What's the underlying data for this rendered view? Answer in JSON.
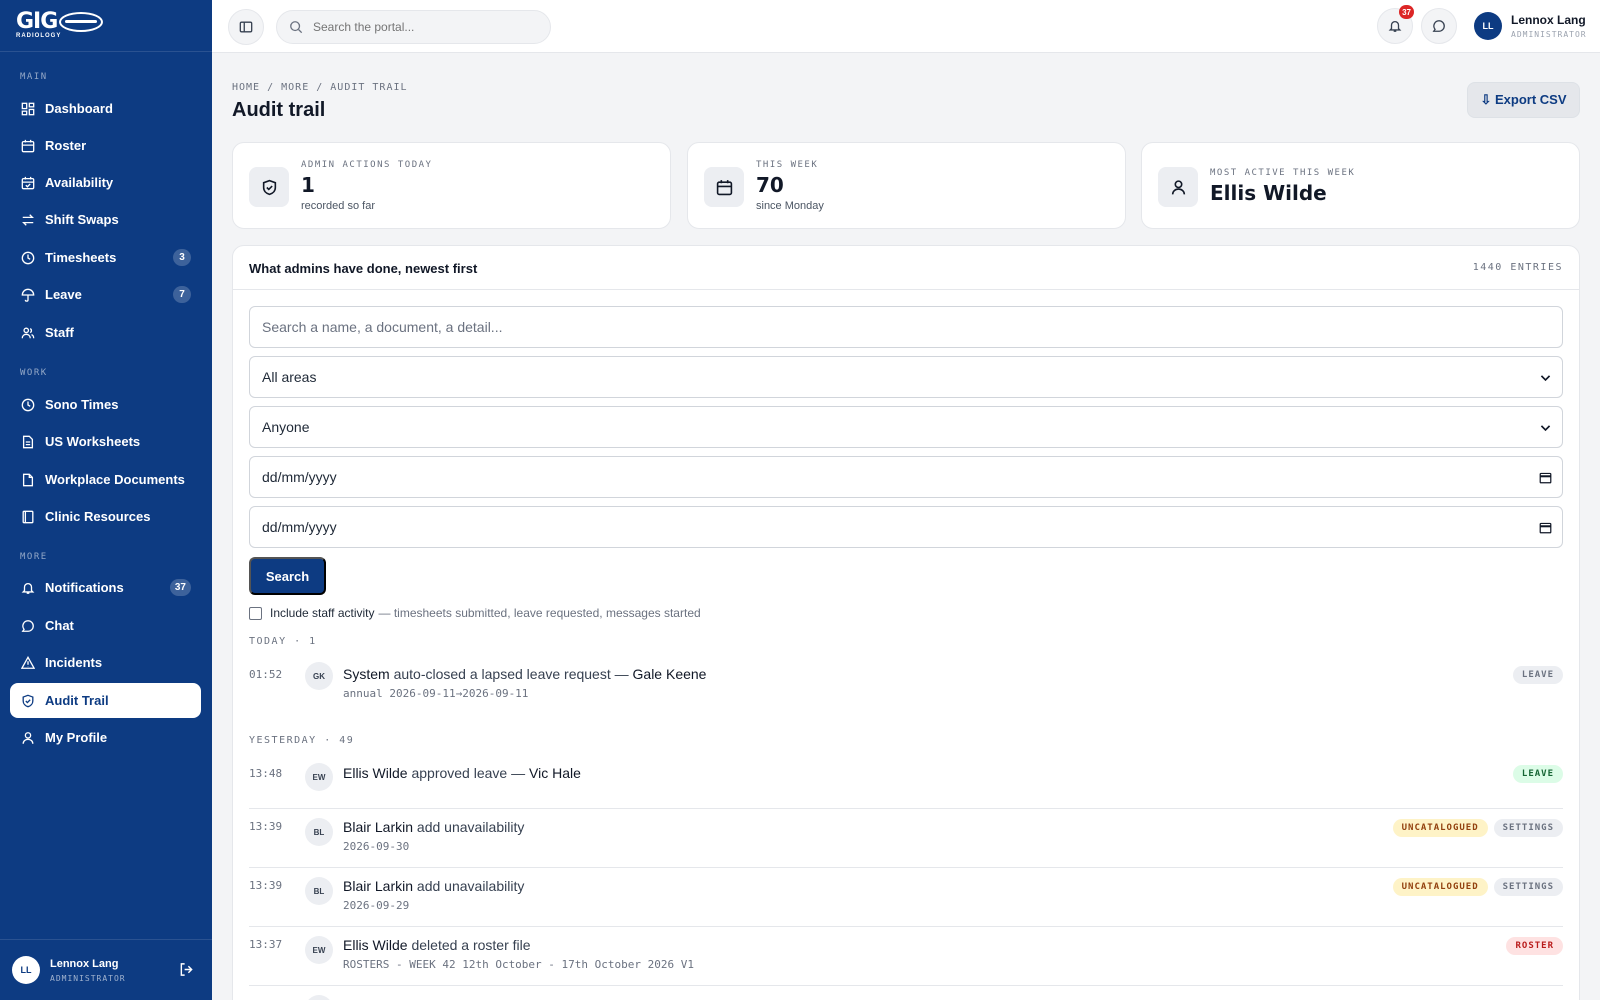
{
  "brand": {
    "logo_text": "GIG",
    "logo_sub": "RADIOLOGY"
  },
  "sidebar": {
    "sections": {
      "main": "MAIN",
      "work": "WORK",
      "more": "MORE"
    },
    "items": [
      {
        "label": "Dashboard",
        "icon": "dashboard-icon"
      },
      {
        "label": "Roster",
        "icon": "calendar-icon"
      },
      {
        "label": "Availability",
        "icon": "calendar-check-icon"
      },
      {
        "label": "Shift Swaps",
        "icon": "swap-icon"
      },
      {
        "label": "Timesheets",
        "icon": "clock-icon",
        "badge": "3"
      },
      {
        "label": "Leave",
        "icon": "umbrella-icon",
        "badge": "7"
      },
      {
        "label": "Staff",
        "icon": "users-icon"
      },
      {
        "label": "Sono Times",
        "icon": "clock-icon"
      },
      {
        "label": "US Worksheets",
        "icon": "document-icon"
      },
      {
        "label": "Workplace Documents",
        "icon": "folder-icon"
      },
      {
        "label": "Clinic Resources",
        "icon": "book-icon"
      },
      {
        "label": "Notifications",
        "icon": "bell-icon",
        "badge": "37"
      },
      {
        "label": "Chat",
        "icon": "chat-icon"
      },
      {
        "label": "Incidents",
        "icon": "warning-icon"
      },
      {
        "label": "Audit Trail",
        "icon": "shield-icon",
        "active": true
      },
      {
        "label": "My Profile",
        "icon": "user-icon"
      }
    ],
    "user": {
      "initials": "LL",
      "name": "Lennox Lang",
      "role": "ADMINISTRATOR"
    }
  },
  "topbar": {
    "search_placeholder": "Search the portal...",
    "notification_count": "37",
    "user": {
      "initials": "LL",
      "name": "Lennox Lang",
      "role": "ADMINISTRATOR"
    }
  },
  "page": {
    "breadcrumb": "HOME / MORE / AUDIT TRAIL",
    "title": "Audit trail",
    "export_label": "⇩ Export CSV"
  },
  "stats": [
    {
      "label": "ADMIN ACTIONS TODAY",
      "value": "1",
      "sub": "recorded so far",
      "icon": "shield-icon"
    },
    {
      "label": "THIS WEEK",
      "value": "70",
      "sub": "since Monday",
      "icon": "calendar-icon"
    },
    {
      "label": "MOST ACTIVE THIS WEEK",
      "value": "Ellis Wilde",
      "sub": "",
      "icon": "user-icon"
    }
  ],
  "panel": {
    "title": "What admins have done, newest first",
    "count": "1440 ENTRIES",
    "filters": {
      "search_placeholder": "Search a name, a document, a detail...",
      "area": "All areas",
      "person": "Anyone",
      "date_from": "dd/mm/yyyy",
      "date_to": "dd/mm/yyyy"
    },
    "search_label": "Search",
    "checkbox_label": "Include staff activity",
    "checkbox_hint": "— timesheets submitted, leave requested, messages started",
    "groups": [
      {
        "label": "TODAY · 1"
      },
      {
        "label": "YESTERDAY · 49"
      }
    ],
    "entries": [
      {
        "time": "01:52",
        "initials": "GK",
        "actor": "System",
        "action": "auto-closed a lapsed leave request —",
        "target": "Gale Keene",
        "detail": "annual 2026-09-11→2026-09-11",
        "tags": [
          {
            "label": "LEAVE",
            "tone": "gray"
          }
        ]
      },
      {
        "time": "13:48",
        "initials": "EW",
        "actor": "Ellis Wilde",
        "action": "approved leave —",
        "target": "Vic Hale",
        "detail": "",
        "tags": [
          {
            "label": "LEAVE",
            "tone": "green"
          }
        ]
      },
      {
        "time": "13:39",
        "initials": "BL",
        "actor": "Blair Larkin",
        "action": "add unavailability",
        "target": "",
        "detail": "2026-09-30",
        "tags": [
          {
            "label": "UNCATALOGUED",
            "tone": "amber"
          },
          {
            "label": "SETTINGS",
            "tone": "gray"
          }
        ]
      },
      {
        "time": "13:39",
        "initials": "BL",
        "actor": "Blair Larkin",
        "action": "add unavailability",
        "target": "",
        "detail": "2026-09-29",
        "tags": [
          {
            "label": "UNCATALOGUED",
            "tone": "amber"
          },
          {
            "label": "SETTINGS",
            "tone": "gray"
          }
        ]
      },
      {
        "time": "13:37",
        "initials": "EW",
        "actor": "Ellis Wilde",
        "action": "deleted a roster file",
        "target": "",
        "detail": "ROSTERS - WEEK 42 12th October - 17th October 2026 V1",
        "tags": [
          {
            "label": "ROSTER",
            "tone": "red"
          }
        ]
      }
    ]
  },
  "colors": {
    "brand": "#0d3b82",
    "notification": "#dc2626"
  }
}
